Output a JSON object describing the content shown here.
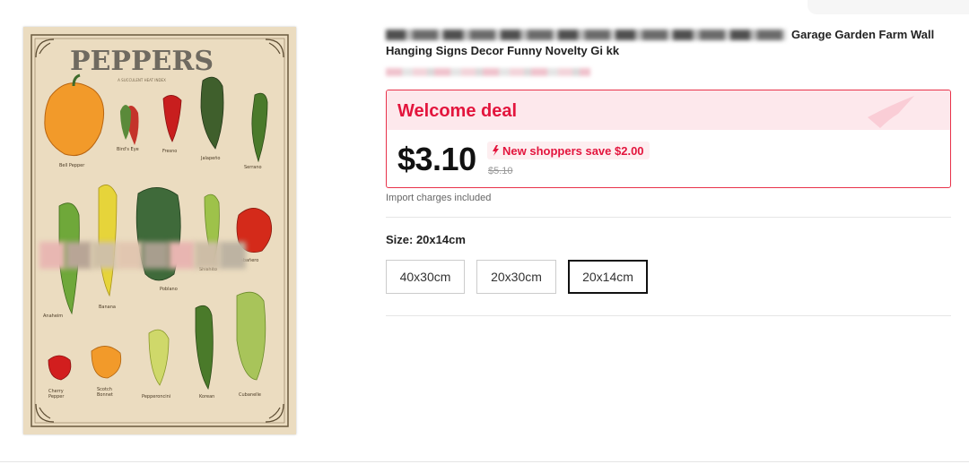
{
  "product": {
    "title_visible_part": "Garage Garden Farm Wall",
    "title_line2": "Hanging Signs Decor Funny Novelty Gi kk",
    "image": {
      "poster_title": "PEPPERS",
      "poster_subtitle": "A SUCCULENT HEAT INDEX",
      "peppers": [
        "Bell Pepper",
        "Bird's Eye",
        "Fresno",
        "Jalapeño",
        "Serrano",
        "Shishito",
        "Poblano",
        "Habañero",
        "Anaheim",
        "Banana",
        "Cherry Pepper",
        "Scotch Bonnet",
        "Pepperoncini",
        "Korean",
        "Cubanelle"
      ]
    }
  },
  "deal": {
    "title": "Welcome deal",
    "price": "$3.10",
    "save_text": "New shoppers save $2.00",
    "original_price": "$5.10",
    "accent_color": "#e3153d"
  },
  "import_note": "Import charges included",
  "size": {
    "label": "Size: 20x14cm",
    "options": [
      "40x30cm",
      "20x30cm",
      "20x14cm"
    ],
    "selected": "20x14cm"
  }
}
